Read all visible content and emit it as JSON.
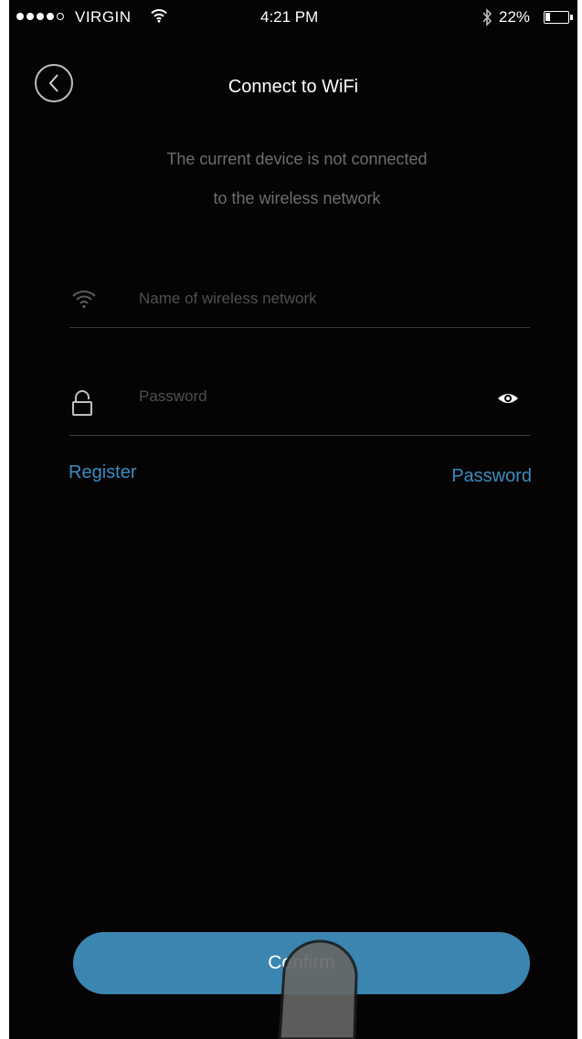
{
  "status_bar": {
    "carrier": "VIRGIN",
    "time": "4:21 PM",
    "battery": "22%",
    "battery_level": 0.22,
    "bluetooth_icon": "bluetooth-icon",
    "wifi_icon": "wifi-icon"
  },
  "header": {
    "title": "Connect to WiFi",
    "back_icon": "chevron-left-icon"
  },
  "message": {
    "line1": "The current device is not connected",
    "line2": "to the wireless network"
  },
  "form": {
    "ssid_placeholder": "Name of wireless network",
    "ssid_value": "",
    "password_placeholder": "Password",
    "password_value": "",
    "ssid_icon": "wifi-icon",
    "password_icon": "lock-icon",
    "visibility_icon": "eye-icon"
  },
  "links": {
    "register": "Register",
    "password": "Password"
  },
  "actions": {
    "confirm": "Confirm"
  },
  "colors": {
    "background": "#050304",
    "accent": "#3b86b1",
    "link": "#3b8cc0"
  }
}
